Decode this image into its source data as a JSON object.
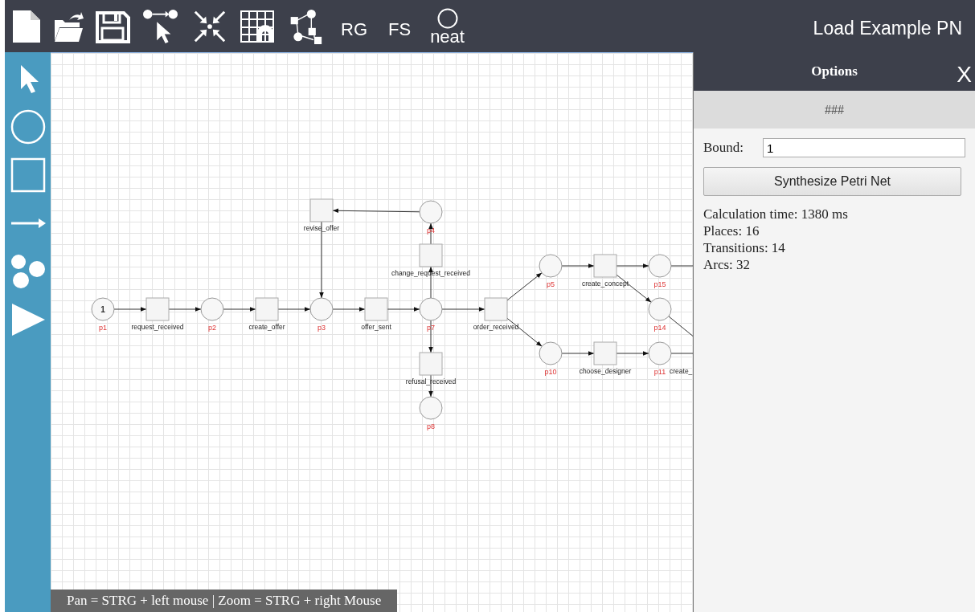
{
  "toolbar": {
    "text_buttons": [
      "RG",
      "FS"
    ],
    "neat_label": "neat",
    "example_button": "Load Example PN"
  },
  "net": {
    "nodes": [
      {
        "kind": "place",
        "label": "p1",
        "tokens": "1"
      },
      {
        "kind": "transition",
        "label": "request_received"
      },
      {
        "kind": "place",
        "label": "p2"
      },
      {
        "kind": "transition",
        "label": "create_offer"
      },
      {
        "kind": "place",
        "label": "p3"
      },
      {
        "kind": "transition",
        "label": "offer_sent"
      },
      {
        "kind": "place",
        "label": "p7"
      },
      {
        "kind": "transition",
        "label": "revise_offer"
      },
      {
        "kind": "place",
        "label": "p4"
      },
      {
        "kind": "transition",
        "label": "change_request_received"
      },
      {
        "kind": "transition",
        "label": "refusal_received"
      },
      {
        "kind": "place",
        "label": "p8"
      },
      {
        "kind": "transition",
        "label": "order_received"
      },
      {
        "kind": "place",
        "label": "p5"
      },
      {
        "kind": "place",
        "label": "p10"
      },
      {
        "kind": "transition",
        "label": "create_concept"
      },
      {
        "kind": "transition",
        "label": "choose_designer"
      },
      {
        "kind": "place",
        "label": "p15"
      },
      {
        "kind": "place",
        "label": "p14"
      },
      {
        "kind": "place",
        "label": "p11"
      }
    ],
    "cut_labels": [
      "create_"
    ]
  },
  "hint": "Pan = STRG + left mouse | Zoom = STRG + right Mouse",
  "options": {
    "title": "Options",
    "close": "X",
    "subtitle": "###",
    "bound_label": "Bound:",
    "bound_value": "1",
    "button": "Synthesize Petri Net",
    "stats": [
      "Calculation time: 1380 ms",
      "Places: 16",
      "Transitions: 14",
      "Arcs: 32"
    ]
  }
}
